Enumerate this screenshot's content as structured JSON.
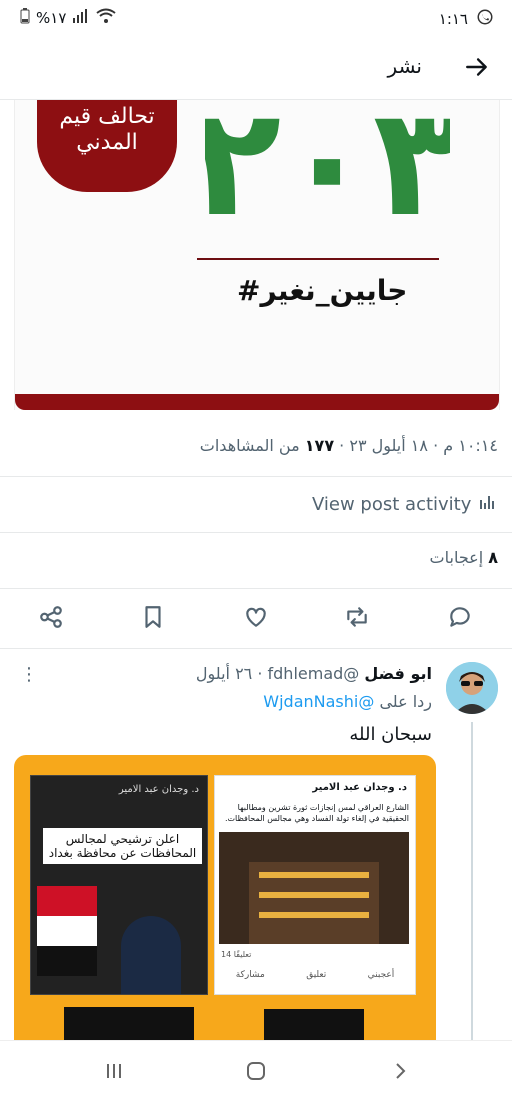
{
  "status_bar": {
    "time": "١:١٦",
    "battery": "%١٧"
  },
  "header": {
    "title": "نشر"
  },
  "post_image": {
    "badge_line1": "تحالف قيم",
    "badge_line2": "المدني",
    "big_text": "٢٠٣",
    "hashtag": "#جايين_نغير"
  },
  "post_meta": {
    "time_date": "١٠:١٤ م · ١٨ أيلول ٢٣",
    "views_count": "١٧٧",
    "views_label": "من المشاهدات"
  },
  "activity": {
    "label": "View post activity"
  },
  "likes": {
    "count": "٨",
    "label": "إعجابات"
  },
  "reply": {
    "name": "ابو فضل",
    "handle": "@fdhlemad",
    "date": "٢٦ أيلول",
    "replying_to_label": "ردا على",
    "replying_to_handle": "@WjdanNashi",
    "text": "سبحان الله",
    "image": {
      "left_caption_1": "اعلن ترشيحي لمجالس",
      "left_caption_2": "المحافظات عن محافظة بغداد",
      "right_name": "د. وجدان عبد الامير",
      "right_text": "الشارع العراقي لمس إنجازات ثورة تشرين ومطالبها الحقيقية في إلغاء تولة الفساد وهي مجالس المحافظات.",
      "fb_like": "أعجبني",
      "fb_comment": "تعليق",
      "fb_share": "مشاركة",
      "fb_count": "14 تعليقًا"
    }
  },
  "colors": {
    "accent": "#1d9bf0",
    "brand_red": "#8d0f12",
    "brand_green": "#2e8b3e",
    "banner_orange": "#f7a81b"
  }
}
